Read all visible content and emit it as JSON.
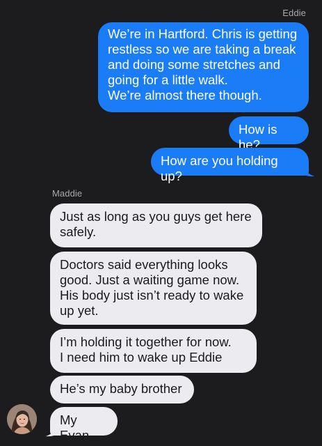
{
  "conversation": {
    "outgoing_name": "Eddie",
    "incoming_name": "Maddie",
    "outgoing": [
      "We’re in Hartford. Chris is getting\nrestless so we are taking a break\nand doing some stretches and\ngoing for a little walk.\nWe’re almost there though.",
      "How is he?",
      "How are you holding up?"
    ],
    "incoming": [
      "Just as long as you guys get here\nsafely.",
      "Doctors said everything looks\ngood. Just a waiting game now.\nHis body just isn’t ready to wake\nup yet.",
      "I’m holding it together for now.\nI need him to wake up Eddie",
      "He’s my baby brother",
      "My Evan"
    ]
  },
  "colors": {
    "background": "#1c1c1e",
    "outgoing_bubble": "#1a7cf7",
    "incoming_bubble": "#ececf0",
    "name_label": "#a9a9ae"
  }
}
